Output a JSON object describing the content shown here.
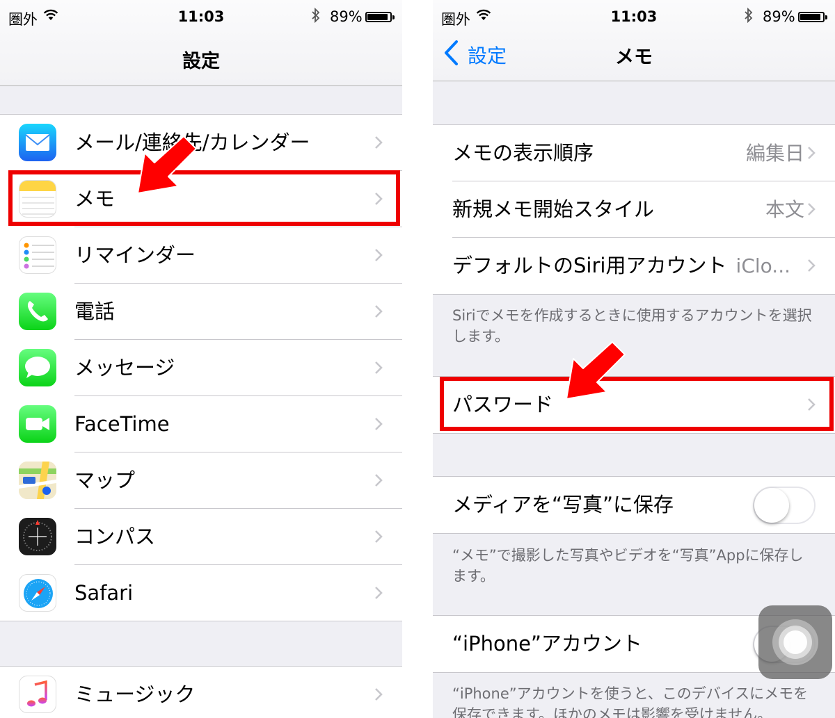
{
  "status_bar": {
    "carrier": "圏外",
    "time": "11:03",
    "battery": "89%",
    "icons": [
      "wifi-icon",
      "bluetooth-icon",
      "battery-icon"
    ]
  },
  "left": {
    "nav_title": "設定",
    "items": [
      {
        "label": "メール/連絡先/カレンダー",
        "icon": "mail-icon"
      },
      {
        "label": "メモ",
        "icon": "notes-icon"
      },
      {
        "label": "リマインダー",
        "icon": "reminders-icon"
      },
      {
        "label": "電話",
        "icon": "phone-icon"
      },
      {
        "label": "メッセージ",
        "icon": "messages-icon"
      },
      {
        "label": "FaceTime",
        "icon": "facetime-icon"
      },
      {
        "label": "マップ",
        "icon": "maps-icon"
      },
      {
        "label": "コンパス",
        "icon": "compass-icon"
      },
      {
        "label": "Safari",
        "icon": "safari-icon"
      }
    ],
    "items2": [
      {
        "label": "ミュージック",
        "icon": "music-icon"
      }
    ]
  },
  "right": {
    "back_label": "設定",
    "nav_title": "メモ",
    "group1": [
      {
        "label": "メモの表示順序",
        "value": "編集日"
      },
      {
        "label": "新規メモ開始スタイル",
        "value": "本文"
      },
      {
        "label": "デフォルトのSiri用アカウント",
        "value": "iClo..."
      }
    ],
    "footer1": "Siriでメモを作成するときに使用するアカウントを選択します。",
    "password_label": "パスワード",
    "media_label": "メディアを“写真”に保存",
    "media_on": false,
    "footer2": "“メモ”で撮影した写真やビデオを“写真”Appに保存します。",
    "iphone_account_label": "“iPhone”アカウント",
    "footer3": "“iPhone”アカウントを使うと、このデバイスにメモを保存できます。ほかのメモは影響を受けません。"
  },
  "colors": {
    "accent": "#007aff",
    "highlight": "#ee0000",
    "arrow": "#ff0000",
    "separator": "#c8c7cc",
    "background": "#efeff4"
  }
}
